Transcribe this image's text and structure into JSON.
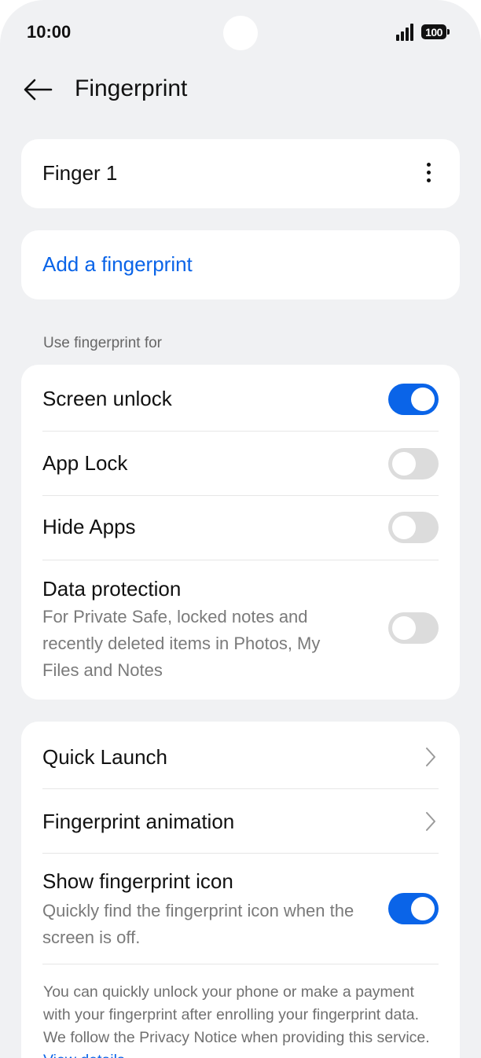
{
  "status_bar": {
    "time": "10:00",
    "battery": "100"
  },
  "header": {
    "title": "Fingerprint"
  },
  "fingers": [
    {
      "label": "Finger 1"
    }
  ],
  "add_fingerprint": {
    "label": "Add a fingerprint"
  },
  "use_for": {
    "header": "Use fingerprint for",
    "items": [
      {
        "label": "Screen unlock",
        "enabled": true
      },
      {
        "label": "App Lock",
        "enabled": false
      },
      {
        "label": "Hide Apps",
        "enabled": false
      },
      {
        "label": "Data protection",
        "description": "For Private Safe, locked notes and recently deleted items in Photos, My Files and Notes",
        "enabled": false
      }
    ]
  },
  "more_settings": {
    "quick_launch": "Quick Launch",
    "fingerprint_animation": "Fingerprint animation",
    "show_icon": {
      "label": "Show fingerprint icon",
      "description": "Quickly find the fingerprint icon when the screen is off.",
      "enabled": true
    }
  },
  "footer": {
    "text": "You can quickly unlock your phone or make a payment with your fingerprint after enrolling your fingerprint data. We follow the Privacy Notice when providing this service. ",
    "link": "View details"
  },
  "colors": {
    "accent": "#0a64e8",
    "background": "#f0f1f3",
    "card": "#ffffff",
    "toggle_off": "#dcdcdc"
  }
}
